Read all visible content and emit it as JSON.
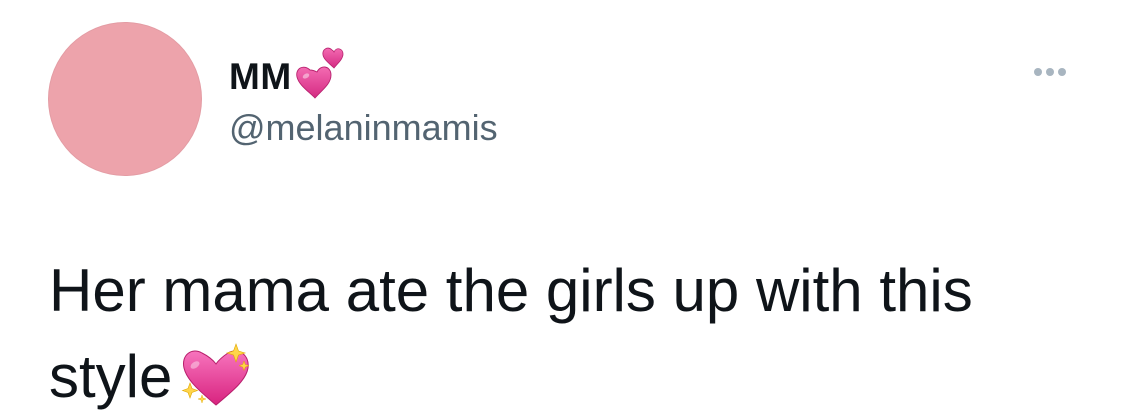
{
  "tweet": {
    "author": {
      "display_name": "MM",
      "name_emoji": "two-hearts-icon",
      "handle": "@melaninmamis",
      "avatar_color": "#eda3ab"
    },
    "text": "Her mama ate the girls up with this style",
    "text_emoji": "sparkling-heart-icon",
    "more_menu_icon": "more-options-icon"
  },
  "colors": {
    "name": "#0f1419",
    "handle": "#536471",
    "body_text": "#0f1419",
    "menu_dots": "#a8b5c0",
    "emoji_pink": "#e43b8f"
  }
}
